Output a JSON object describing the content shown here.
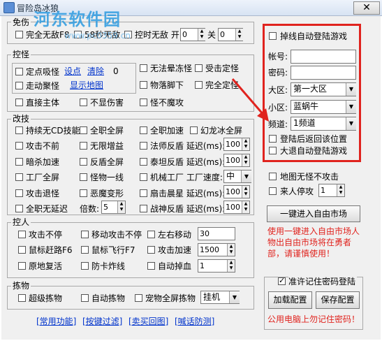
{
  "window": {
    "title": "冒险岛冰狼",
    "close_glyph": "✕"
  },
  "watermark": {
    "brand": "河东软件园",
    "url": "www.pc0359.cn"
  },
  "top": {
    "legend": "免伤",
    "invincible_f8": "完全无敌F8",
    "invincible_58s": "58秒无敌",
    "timed_invincible": "控时无敌 开",
    "on_value": "0",
    "off_label": "关",
    "off_value": "0"
  },
  "monster": {
    "legend": "控怪",
    "fixed_suck": "定点吸怪",
    "set_point": "设点",
    "clear": "清除",
    "count": "0",
    "walk_suck": "走动聚怪",
    "show_map": "显示地图",
    "no_faint": "无法晕冻怪",
    "hit_fixed": "受击定怪",
    "drop_under": "物落脚下",
    "full_fixed": "完全定怪",
    "direct_main": "直接主体",
    "no_damage_show": "不显伤害",
    "monster_no_attack": "怪不魔攻"
  },
  "skills": {
    "legend": "改技",
    "rows": [
      [
        "持续无CD技能",
        "全职全屏",
        "全职加速",
        "幻龙冰全屏"
      ],
      [
        "攻击不前",
        "无限增益",
        "法师反盾 延迟(ms):",
        ""
      ],
      [
        "暗杀加速",
        "反盾全屏",
        "泰坦反盾 延迟(ms):",
        ""
      ],
      [
        "工厂全屏",
        "怪物一线",
        "机械工厂 工厂速度:",
        ""
      ],
      [
        "攻击退怪",
        "恶魔变形",
        "扇击晨星 延迟(ms):",
        ""
      ],
      [
        "全职无延迟",
        "倍数:",
        "战神反盾 延迟(ms):",
        ""
      ]
    ],
    "mage_delay": "100",
    "titan_delay": "100",
    "factory_speed": "中",
    "fan_delay": "100",
    "war_delay": "100",
    "multiplier": "5"
  },
  "control": {
    "legend": "控人",
    "attack_nonstop": "攻击不停",
    "move_attack_nonstop": "移动攻击不停",
    "left_right_move": "左右移动",
    "left_right_value": "30",
    "mouse_fast": "鼠标赶路F6",
    "mouse_fly": "鼠标飞行F7",
    "attack_speed": "攻击加速",
    "attack_speed_value": "1500",
    "revive": "原地复活",
    "anti_lag": "防卡炸线",
    "auto_drop": "自动掉血",
    "auto_drop_value": "1"
  },
  "pickup": {
    "legend": "拣物",
    "super_pickup": "超级拣物",
    "auto_pickup": "自动拣物",
    "pet_pickup": "宠物全屏拣物",
    "mode": "挂机"
  },
  "bottom_links": [
    "[常用功能]",
    "[按键过滤]",
    "[卖买回图]",
    "[喊话防测]"
  ],
  "login": {
    "auto_login": "掉线自动登陆游戏",
    "account_label": "帐号:",
    "account_value": "",
    "password_label": "密码:",
    "password_value": "",
    "region_label": "大区:",
    "region_value": "第一大区",
    "zone_label": "小区:",
    "zone_value": "蓝蜗牛",
    "channel_label": "频道:",
    "channel_value": "1频道",
    "return_position": "登陆后返回该位置",
    "exit_auto_login": "大退自动登陆游戏"
  },
  "misc": {
    "map_no_attack": "地图无怪不攻击",
    "stop_on_player": "来人停攻",
    "stop_value": "1"
  },
  "market": {
    "button": "一键进入自由市场",
    "note": "使用一键进入自由市场人物出自由市场将在勇者部，请谨慎使用！"
  },
  "password_panel": {
    "allow_remember": "准许记住密码登陆",
    "load_config": "加载配置",
    "save_config": "保存配置",
    "warning": "公用电脑上勿记住密码！"
  },
  "colors": {
    "highlight": "#e0231e",
    "link": "#0033cc",
    "watermark": "#2d9be0"
  }
}
